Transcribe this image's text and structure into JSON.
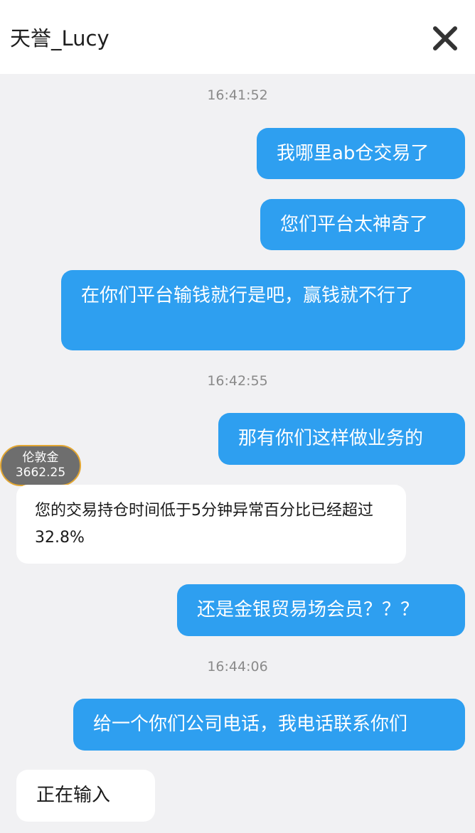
{
  "header": {
    "title": "天誉_Lucy",
    "close_icon": "close-icon"
  },
  "timestamps": [
    "16:41:52",
    "16:42:55",
    "16:44:06"
  ],
  "messages": [
    {
      "side": "me",
      "text": "我哪里ab仓交易了"
    },
    {
      "side": "me",
      "text": "您们平台太神奇了"
    },
    {
      "side": "me",
      "text": "在你们平台输钱就行是吧，赢钱就不行了"
    },
    {
      "side": "me",
      "text": "那有你们这样做业务的"
    },
    {
      "side": "them",
      "text": "您的交易持仓时间低于5分钟异常百分比已经超过32.8%"
    },
    {
      "side": "me",
      "text": "还是金银贸易场会员？？？"
    },
    {
      "side": "me",
      "text": "给一个你们公司电话，我电话联系你们"
    },
    {
      "side": "them",
      "text": "正在输入"
    }
  ],
  "avatar": {
    "line1": "伦敦金",
    "line2": "3662.25"
  },
  "colors": {
    "outgoing_bubble": "#2e9ff0",
    "incoming_bubble": "#ffffff",
    "chat_background": "#f1f1f3",
    "avatar_border": "#e2a632"
  }
}
